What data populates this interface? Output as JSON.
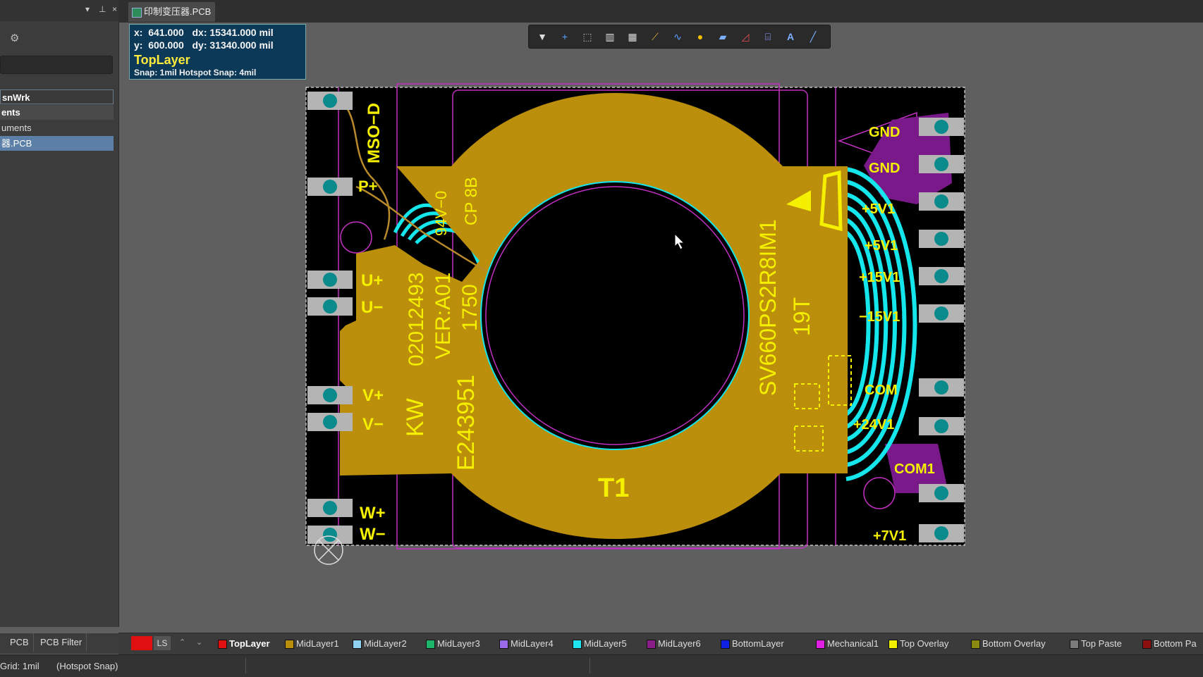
{
  "panel": {
    "workspace_label": "snWrk",
    "project_label": "ents",
    "documents_label": "uments",
    "pcb_item_label": "器.PCB",
    "tabs": [
      "PCB",
      "PCB Filter"
    ]
  },
  "document_tab": {
    "title": "印制变压器.PCB"
  },
  "hud": {
    "x_line": "x:  641.000   dx: 15341.000 mil",
    "y_line": "y:  600.000   dy: 31340.000 mil",
    "layer": "TopLayer",
    "snap": "Snap: 1mil Hotspot Snap: 4mil"
  },
  "pcb_labels": {
    "mso_d": "MSO−D",
    "p_plus": "P+",
    "u_plus": "U+",
    "u_minus": "U−",
    "v_plus": "V+",
    "v_minus": "V−",
    "w_plus": "W+",
    "w_minus": "W−",
    "gnd1": "GND",
    "gnd2": "GND",
    "p5v1a": "+5V1",
    "p5v1b": "+5V1",
    "p15v1": "+15V1",
    "m15v1": "−15V1",
    "com": "COM",
    "p24v1": "+24V1",
    "com1": "COM1",
    "p7v1": "+7V1",
    "part_number": "02012493",
    "version": "VER:A01",
    "cert": "E243951",
    "date_code": "1750",
    "kw": "KW",
    "flammability": "94V−0",
    "cp": "CP 8B",
    "designator": "T1",
    "model": "SV660PS2R8IM1",
    "turns": "19T"
  },
  "layer_bar": {
    "ls_label": "LS",
    "layers": [
      {
        "name": "TopLayer",
        "color": "#e01010",
        "active": true
      },
      {
        "name": "MidLayer1",
        "color": "#b8900e"
      },
      {
        "name": "MidLayer2",
        "color": "#8fd2f0"
      },
      {
        "name": "MidLayer3",
        "color": "#1db56a"
      },
      {
        "name": "MidLayer4",
        "color": "#9a6be8"
      },
      {
        "name": "MidLayer5",
        "color": "#20e4f0"
      },
      {
        "name": "MidLayer6",
        "color": "#8a1f8a"
      },
      {
        "name": "BottomLayer",
        "color": "#1020e0"
      },
      {
        "name": "Mechanical1",
        "color": "#e020e0"
      },
      {
        "name": "Top Overlay",
        "color": "#f0f000"
      },
      {
        "name": "Bottom Overlay",
        "color": "#8a8a10"
      },
      {
        "name": "Top Paste",
        "color": "#7a7a7a"
      },
      {
        "name": "Bottom Pa",
        "color": "#8a1010"
      }
    ]
  },
  "status": {
    "grid": "Grid: 1mil",
    "snap_mode": "(Hotspot Snap)"
  },
  "colors": {
    "copper": "#bb8e0c",
    "board": "#000000",
    "silkscreen": "#f4f000",
    "pad": "#b4b4b4",
    "via": "#0a8a8a",
    "trace_cyan": "#14e6ec",
    "outline": "#d040d0",
    "mech_violet": "#7a1a8a"
  }
}
